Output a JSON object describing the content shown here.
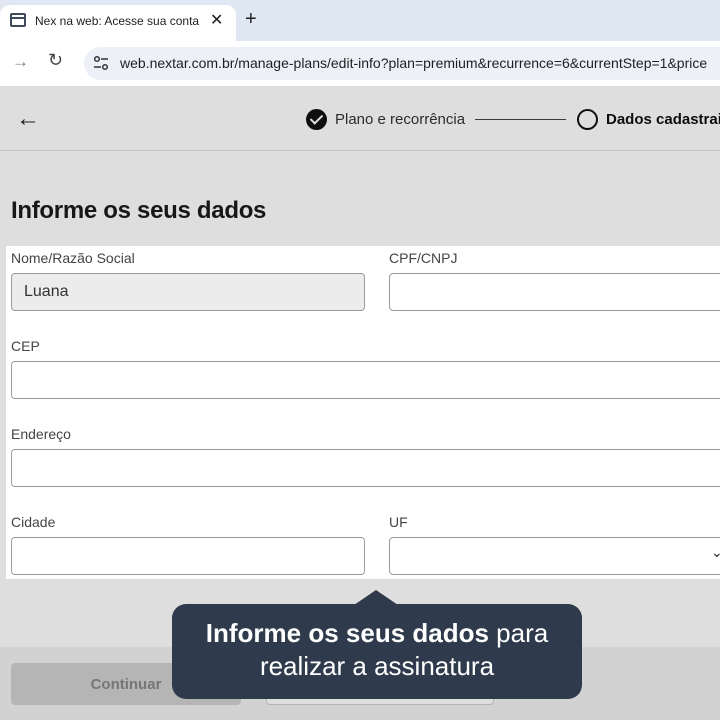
{
  "browser": {
    "tab_title": "Nex na web: Acesse sua conta",
    "tab_close": "✕",
    "new_tab": "+",
    "nav_forward": "→",
    "nav_reload": "↻",
    "url": "web.nextar.com.br/manage-plans/edit-info?plan=premium&recurrence=6&currentStep=1&price"
  },
  "stepper": {
    "back": "←",
    "step1_label": "Plano e recorrência",
    "step2_label": "Dados cadastrais"
  },
  "page": {
    "title": "Informe os seus dados"
  },
  "form": {
    "name_label": "Nome/Razão Social",
    "name_value": "Luana",
    "cpf_label": "CPF/CNPJ",
    "cpf_value": "",
    "cep_label": "CEP",
    "cep_value": "",
    "address_label": "Endereço",
    "address_value": "",
    "city_label": "Cidade",
    "city_value": "",
    "uf_label": "UF",
    "uf_value": "",
    "uf_chevron": "⌄"
  },
  "footer": {
    "continue_label": "Continuar"
  },
  "tooltip": {
    "strong": "Informe os seus dados",
    "rest": " para",
    "line2": "realizar a assinatura"
  },
  "colors": {
    "tooltip_bg": "#2f3b4c",
    "browser_tabstrip": "#dfe7f3"
  }
}
